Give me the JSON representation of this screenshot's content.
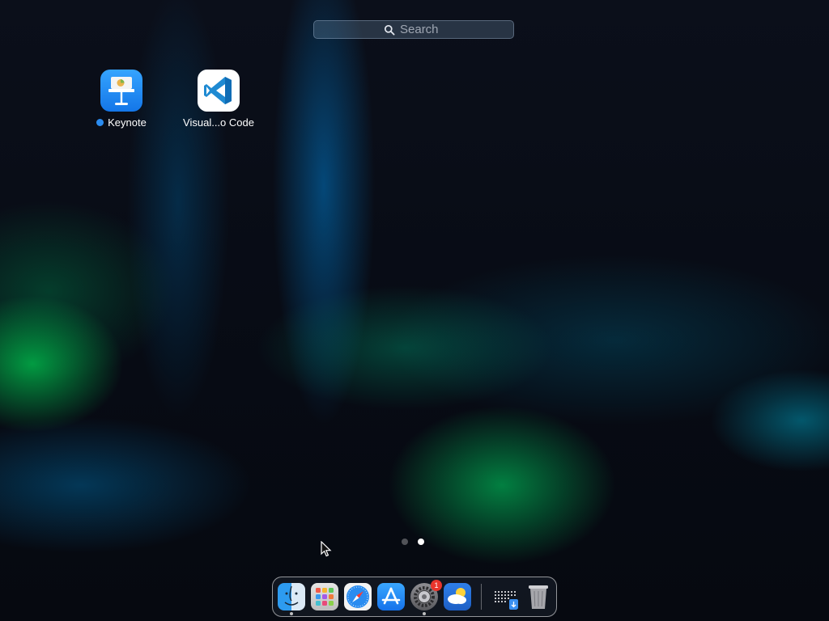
{
  "search": {
    "placeholder": "Search",
    "value": ""
  },
  "apps": [
    {
      "name": "Keynote",
      "new": true,
      "icon": "keynote-icon"
    },
    {
      "name": "Visual...o Code",
      "new": false,
      "icon": "vscode-icon"
    }
  ],
  "pages": {
    "count": 2,
    "current": 2
  },
  "dock": {
    "items": [
      {
        "id": "finder",
        "icon": "finder-icon",
        "running": true
      },
      {
        "id": "launchpad",
        "icon": "launchpad-icon",
        "running": false
      },
      {
        "id": "safari",
        "icon": "safari-icon",
        "running": false
      },
      {
        "id": "app-store",
        "icon": "app-store-icon",
        "running": false
      },
      {
        "id": "system-settings",
        "icon": "gear-icon",
        "running": true,
        "badge": "1"
      },
      {
        "id": "weather",
        "icon": "weather-icon",
        "running": false
      },
      {
        "id": "downloads",
        "icon": "downloads-stack-icon",
        "running": false
      },
      {
        "id": "trash",
        "icon": "trash-icon",
        "running": false
      }
    ]
  },
  "colors": {
    "accent_blue": "#2b8cf0",
    "badge_red": "#e8352c"
  }
}
